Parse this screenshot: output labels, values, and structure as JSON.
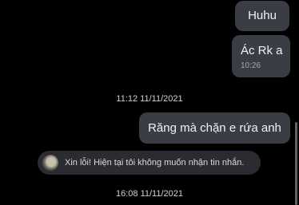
{
  "messages": [
    {
      "text": "Huhu"
    },
    {
      "text": "Ác Rk a",
      "time": "10:26"
    }
  ],
  "separators": [
    "11:12 11/11/2021",
    "16:08 11/11/2021"
  ],
  "reply": {
    "text": "Răng mà chặn e rứa anh"
  },
  "system_notice": {
    "text": "Xin lỗi! Hiện tại tôi không muốn nhận tin nhắn."
  },
  "colors": {
    "background": "#000000",
    "bubble": "#3a3d44",
    "notice_bg": "#2a2c31"
  }
}
